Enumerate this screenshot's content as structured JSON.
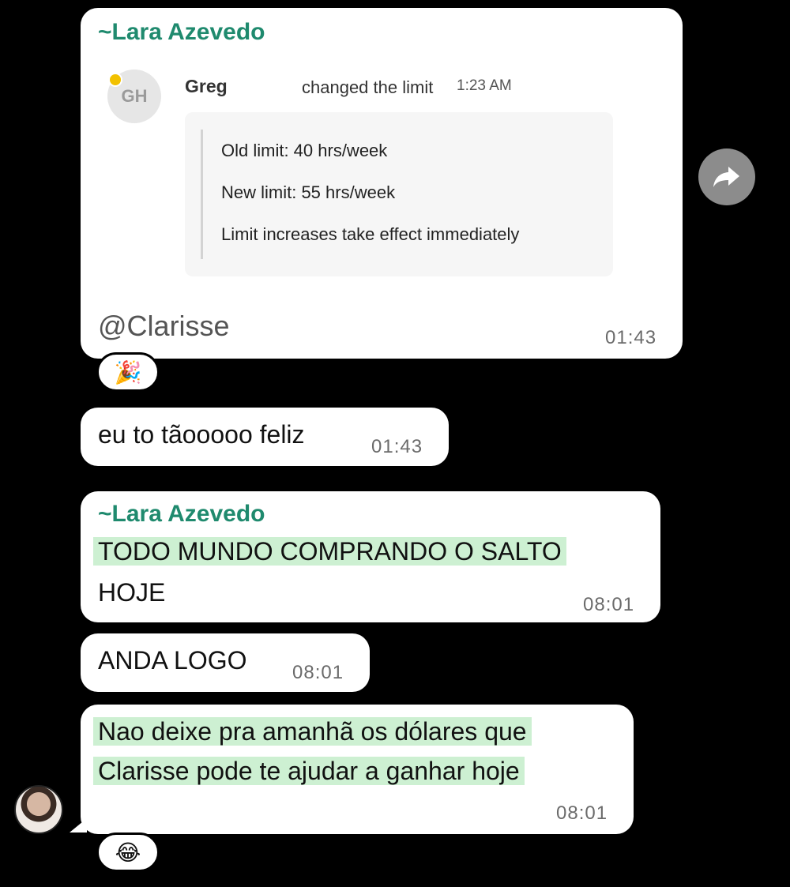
{
  "messages": {
    "m1": {
      "sender": "~Lara Azevedo",
      "embed": {
        "initials": "GH",
        "name": "Greg",
        "action": "changed the limit",
        "action_time": "1:23 AM",
        "lines": [
          "Old limit: 40 hrs/week",
          "New limit: 55 hrs/week",
          "Limit increases take effect immediately"
        ]
      },
      "mention": "@Clarisse",
      "time": "01:43",
      "reaction": "🎉"
    },
    "m2": {
      "text": "eu to tãooooo feliz",
      "time": "01:43"
    },
    "m3": {
      "sender": "~Lara Azevedo",
      "line1": "TODO MUNDO COMPRANDO O SALTO",
      "line2": "HOJE",
      "time": "08:01"
    },
    "m4": {
      "text": "ANDA LOGO",
      "time": "08:01"
    },
    "m5": {
      "line1": "Nao deixe pra amanhã os dólares que",
      "line2": "Clarisse pode te ajudar a ganhar hoje",
      "time": "08:01",
      "reaction": "😂"
    }
  },
  "icons": {
    "forward": "forward-arrow-icon",
    "avatar": "contact-avatar"
  },
  "colors": {
    "sender": "#1f8a6e",
    "highlight": "#cdf0d2",
    "background": "#000000"
  }
}
